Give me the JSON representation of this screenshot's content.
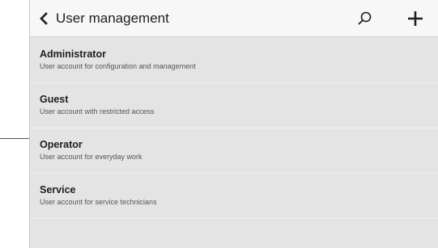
{
  "header": {
    "title": "User management",
    "back_icon": "chevron-left-icon",
    "search_icon": "search-icon",
    "add_icon": "plus-icon"
  },
  "users": [
    {
      "name": "Administrator",
      "description": "User account for configuration and management"
    },
    {
      "name": "Guest",
      "description": "User account with restricted access"
    },
    {
      "name": "Operator",
      "description": "User account for everyday work"
    },
    {
      "name": "Service",
      "description": "User account for service technicians"
    }
  ],
  "colors": {
    "header_bg": "#f7f7f7",
    "list_bg": "#e4e4e4",
    "text": "#1e1e1e"
  }
}
